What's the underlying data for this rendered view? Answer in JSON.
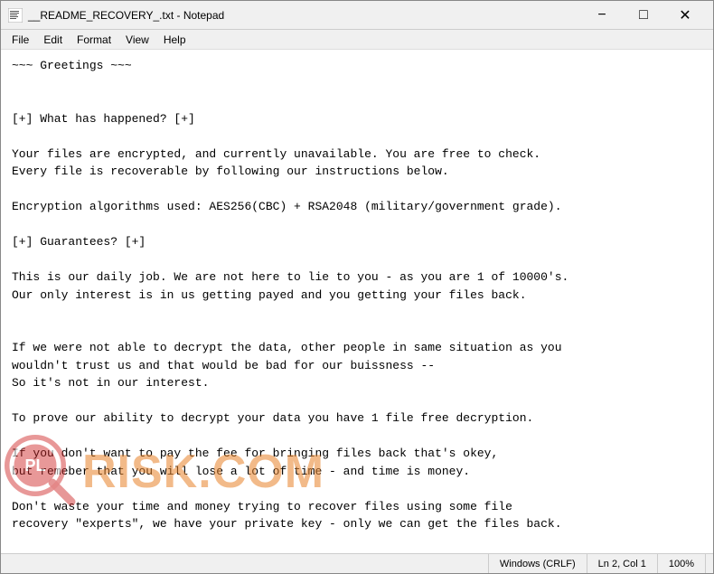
{
  "window": {
    "title": "__README_RECOVERY_.txt - Notepad"
  },
  "titlebar": {
    "minimize_label": "−",
    "maximize_label": "□",
    "close_label": "✕"
  },
  "menubar": {
    "items": [
      "File",
      "Edit",
      "Format",
      "View",
      "Help"
    ]
  },
  "editor": {
    "content": "~~~ Greetings ~~~\n\n\n[+] What has happened? [+]\n\nYour files are encrypted, and currently unavailable. You are free to check.\nEvery file is recoverable by following our instructions below.\n\nEncryption algorithms used: AES256(CBC) + RSA2048 (military/government grade).\n\n[+] Guarantees? [+]\n\nThis is our daily job. We are not here to lie to you - as you are 1 of 10000's.\nOur only interest is in us getting payed and you getting your files back.\n\n\nIf we were not able to decrypt the data, other people in same situation as you\nwouldn't trust us and that would be bad for our buissness --\nSo it's not in our interest.\n\nTo prove our ability to decrypt your data you have 1 file free decryption.\n\nIf you don't want to pay the fee for bringing files back that's okey,\nbut remeber that you will lose a lot of time - and time is money.\n\nDon't waste your time and money trying to recover files using some file\nrecovery \"experts\", we have your private key - only we can get the files back."
  },
  "statusbar": {
    "line_info": "Ln 2, Col 1",
    "encoding": "Windows (CRLF)",
    "zoom": "100%"
  },
  "watermark": {
    "site_text": "PL",
    "risk_text": "RISK",
    "com_text": ".COM"
  }
}
